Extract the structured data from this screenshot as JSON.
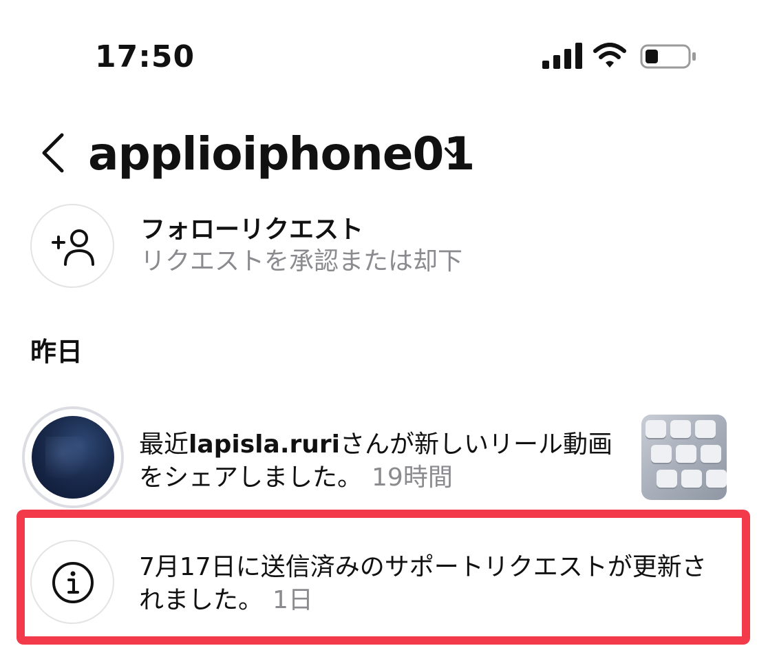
{
  "status_bar": {
    "time": "17:50",
    "icons": [
      "signal-icon",
      "wifi-icon",
      "battery-icon"
    ]
  },
  "header": {
    "account_name": "applioiphone01",
    "icons": [
      "back-icon",
      "chevron-down-icon"
    ]
  },
  "follow_request": {
    "icon": "add-user-icon",
    "title": "フォローリクエスト",
    "subtitle": "リクエストを承認または却下"
  },
  "section": {
    "title": "昨日"
  },
  "notifications": [
    {
      "prefix": "最近",
      "username": "lapisla.ruri",
      "message": "さんが新しいリール動画をシェアしました。",
      "time": "19時間"
    },
    {
      "icon": "info-icon",
      "message": "7月17日に送信済みのサポートリクエストが更新されました。",
      "time": "1日"
    }
  ],
  "colors": {
    "highlight_border": "#f23a4a",
    "secondary_text": "#8a8a8f",
    "primary_text": "#111111"
  }
}
